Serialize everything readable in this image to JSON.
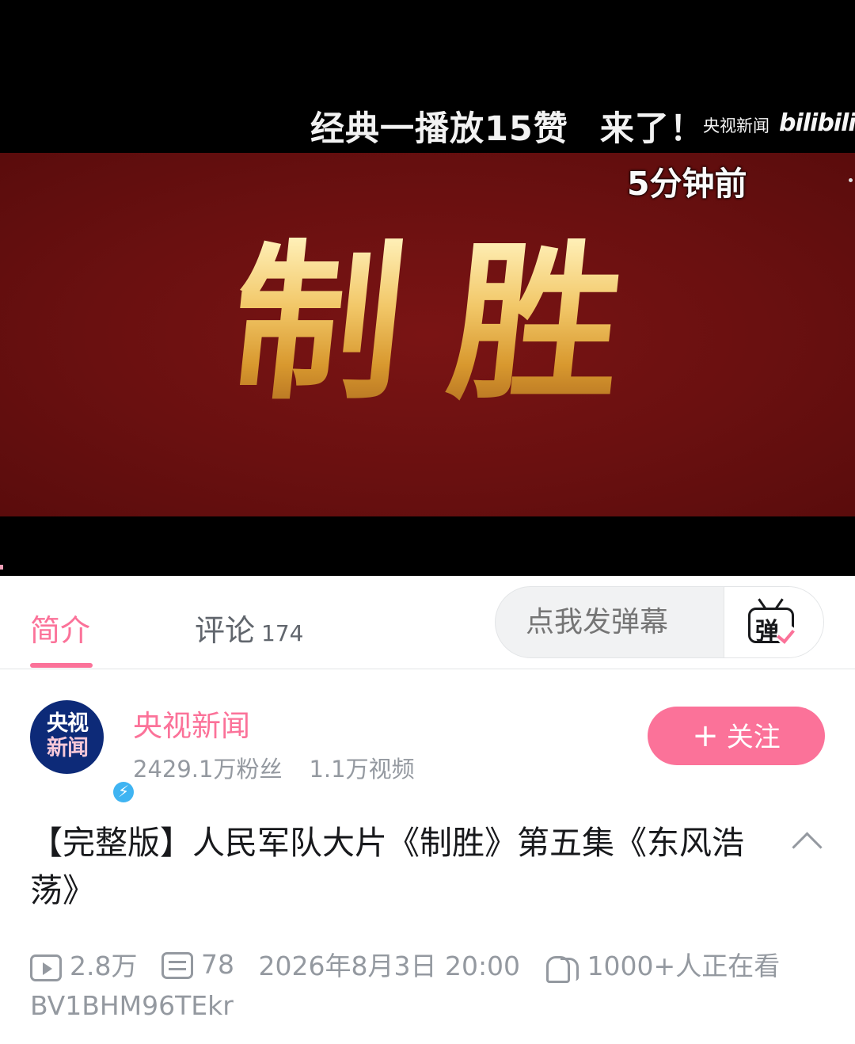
{
  "player": {
    "title_art": "制胜",
    "danmaku_text_1": "经典一播放15赞",
    "danmaku_text_2": "来了！",
    "danmaku_time": "5分钟前",
    "watermark": "央视新闻",
    "bili_logo": "bilibili"
  },
  "tabs": {
    "intro_label": "简介",
    "comments_label": "评论",
    "comments_count": "174",
    "active": "简介"
  },
  "danmaku_input": {
    "placeholder": "点我发弹幕",
    "toggle_char": "弹"
  },
  "uploader": {
    "avatar_line1": "央视",
    "avatar_line2": "新闻",
    "name": "央视新闻",
    "fans": "2429.1万粉丝",
    "videos": "1.1万视频",
    "follow_label": "关注",
    "follow_plus": "+"
  },
  "video": {
    "title": "【完整版】人民军队大片《制胜》第五集《东风浩荡》",
    "views": "2.8万",
    "danmaku_count": "78",
    "date": "2026年8月3日 20:00",
    "watching": "1000+人正在看",
    "bvid": "BV1BHM96TEkr"
  },
  "colors": {
    "accent": "#fb7299",
    "frame_red": "#6a1010",
    "gold": "#e0b255",
    "muted": "#9499a0"
  }
}
